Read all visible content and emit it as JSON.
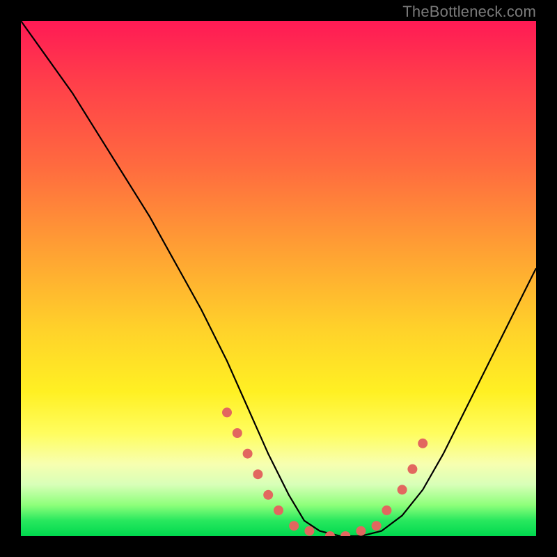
{
  "watermark": "TheBottleneck.com",
  "colors": {
    "background": "#000000",
    "gradient_top": "#ff1a55",
    "gradient_mid": "#ffd22a",
    "gradient_bottom": "#00d84e",
    "curve": "#000000",
    "marker": "#e2675f"
  },
  "chart_data": {
    "type": "line",
    "title": "",
    "xlabel": "",
    "ylabel": "",
    "xlim": [
      0,
      100
    ],
    "ylim": [
      0,
      100
    ],
    "grid": false,
    "legend": false,
    "series": [
      {
        "name": "bottleneck-curve",
        "x": [
          0,
          5,
          10,
          15,
          20,
          25,
          30,
          35,
          40,
          44,
          48,
          52,
          55,
          58,
          62,
          66,
          70,
          74,
          78,
          82,
          86,
          90,
          94,
          98,
          100
        ],
        "y": [
          100,
          93,
          86,
          78,
          70,
          62,
          53,
          44,
          34,
          25,
          16,
          8,
          3,
          1,
          0,
          0,
          1,
          4,
          9,
          16,
          24,
          32,
          40,
          48,
          52
        ]
      }
    ],
    "markers": {
      "name": "highlight-points",
      "x": [
        40,
        42,
        44,
        46,
        48,
        50,
        53,
        56,
        60,
        63,
        66,
        69,
        71,
        74,
        76,
        78
      ],
      "y": [
        24,
        20,
        16,
        12,
        8,
        5,
        2,
        1,
        0,
        0,
        1,
        2,
        5,
        9,
        13,
        18
      ]
    }
  }
}
